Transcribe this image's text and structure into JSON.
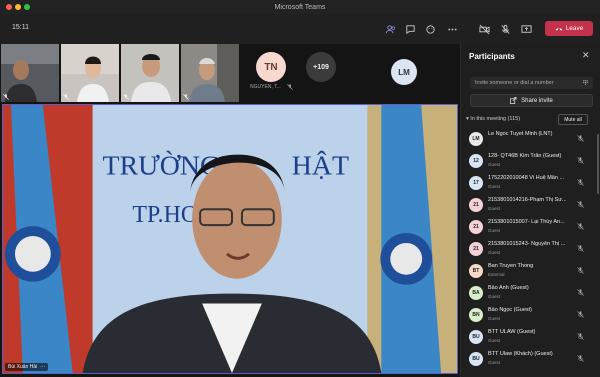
{
  "window": {
    "title": "Microsoft Teams"
  },
  "toolbar": {
    "time": "15:11",
    "leave_label": "Leave"
  },
  "gallery": {
    "tiles": [
      {
        "kind": "video",
        "name": "participant-1"
      },
      {
        "kind": "video",
        "name": "participant-2"
      },
      {
        "kind": "video",
        "name": "participant-3"
      },
      {
        "kind": "video",
        "name": "participant-4"
      }
    ],
    "tn_initials": "TN",
    "tn_name": "NGUYEN, T...",
    "overflow_count": "+109",
    "lm_initials": "LM"
  },
  "main": {
    "speaker": "Bùi Xuân Hải"
  },
  "panel": {
    "title": "Participants",
    "invite_placeholder": "Invite someone or dial a number",
    "share_label": "Share invite",
    "in_meeting": "In this meeting (115)",
    "mute_all": "Mute all",
    "participants": [
      {
        "initials": "LM",
        "name": "Le Ngoc Tuyet Minh (LNT)",
        "sub": "",
        "color": "#e8e8e8"
      },
      {
        "initials": "12",
        "name": "128- QT46B Kim Trân (Guest)",
        "sub": "Guest",
        "color": "#d6e4f5"
      },
      {
        "initials": "17",
        "name": "1752202010048 Vi Huệ Mẫn ...",
        "sub": "Guest",
        "color": "#d6e4f5"
      },
      {
        "initials": "21",
        "name": "2153801014216-Phạm Thị Sư...",
        "sub": "Guest",
        "color": "#f3d1d6"
      },
      {
        "initials": "21",
        "name": "2153801015007- Lại Thùy An...",
        "sub": "Guest",
        "color": "#f3d1d6"
      },
      {
        "initials": "21",
        "name": "2153801015243- Nguyễn Thị ...",
        "sub": "Guest",
        "color": "#f3d1d6"
      },
      {
        "initials": "BT",
        "name": "Ban Truyen Thong",
        "sub": "External",
        "color": "#f6d8c6"
      },
      {
        "initials": "BA",
        "name": "Bảo Anh (Guest)",
        "sub": "Guest",
        "color": "#d9edc8"
      },
      {
        "initials": "BN",
        "name": "Bảo Ngọc (Guest)",
        "sub": "Guest",
        "color": "#d9edc8"
      },
      {
        "initials": "BU",
        "name": "BTT ULAW (Guest)",
        "sub": "Guest",
        "color": "#d6e4f5"
      },
      {
        "initials": "BU",
        "name": "BTT Ulaw (Khách) (Guest)",
        "sub": "Guest",
        "color": "#d6e4f5"
      }
    ]
  }
}
